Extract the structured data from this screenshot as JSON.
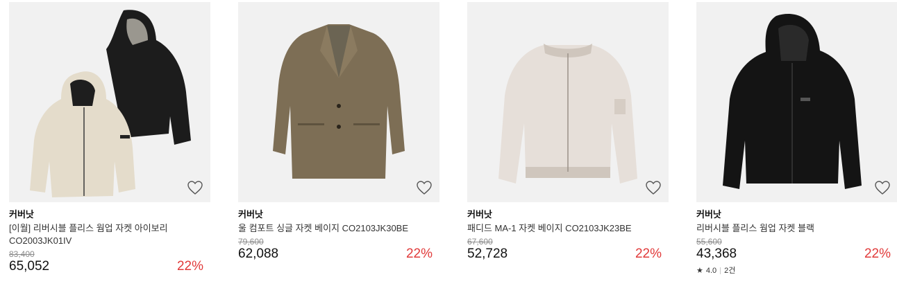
{
  "products": [
    {
      "brand": "커버낫",
      "name": "[이월] 리버시블 플리스 웜업 자켓 아이보리 CO2003JK01IV",
      "original_price": "83,400",
      "price": "65,052",
      "discount": "22%",
      "image": "ivory-and-black-reversible-fleece-hooded-jackets"
    },
    {
      "brand": "커버낫",
      "name": "울 컴포트 싱글 자켓 베이지 CO2103JK30BE",
      "original_price": "79,600",
      "price": "62,088",
      "discount": "22%",
      "image": "beige-single-breasted-blazer"
    },
    {
      "brand": "커버낫",
      "name": "패디드 MA-1 자켓 베이지 CO2103JK23BE",
      "original_price": "67,600",
      "price": "52,728",
      "discount": "22%",
      "image": "beige-padded-ma1-bomber-jacket"
    },
    {
      "brand": "커버낫",
      "name": "리버시블 플리스 웜업 자켓 블랙",
      "original_price": "55,600",
      "price": "43,368",
      "discount": "22%",
      "image": "black-fleece-hooded-jacket",
      "rating": "4.0",
      "review_count": "2건"
    }
  ],
  "colors": {
    "discount": "#e13a3a",
    "thumb_bg": "#f1f1f1",
    "original_price": "#8c8c8c"
  },
  "icons": {
    "wishlist": "heart-outline-icon",
    "rating": "star-icon"
  }
}
